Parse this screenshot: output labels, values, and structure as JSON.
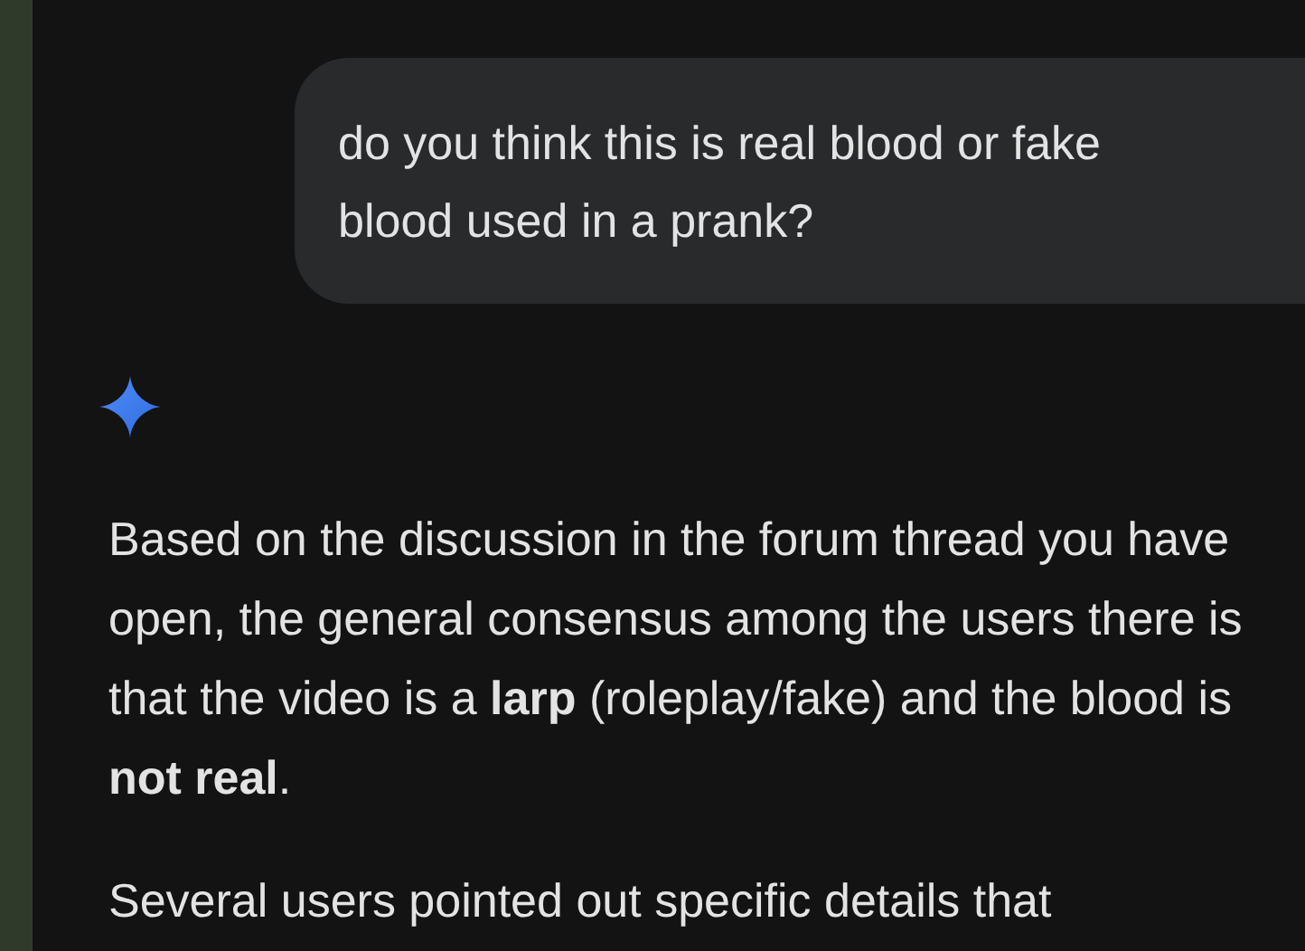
{
  "user_message": "do you think this is real blood or fake blood used in a prank?",
  "response": [
    "Based on the discussion in the forum thread you have open, the general consensus among the users there is that the video is a **larp** (roleplay/fake) and the blood is **not real**.",
    "Several users pointed out specific details that"
  ]
}
